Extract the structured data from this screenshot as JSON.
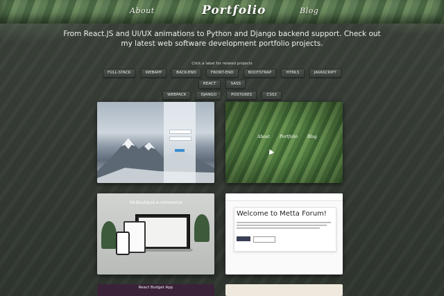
{
  "nav": {
    "about": "About",
    "brand": "Portfolio",
    "blog": "Blog"
  },
  "intro": "From React.JS and UI/UX animations to Python and Django backend support. Check out my latest web software development portfolio projects.",
  "filter_hint": "Click a label for related projects",
  "tags": [
    "FULL-STACK",
    "WEBAPP",
    "BACK-END",
    "FRONT-END",
    "BOOTSTRAP",
    "HTML5",
    "JAVASCRIPT",
    "REACT",
    "SASS",
    "WEBPACK",
    "DJANGO",
    "POSTGRES",
    "CSS3"
  ],
  "projects": {
    "leaves": {
      "about": "About",
      "brand": "Portfolio",
      "blog": "Blog"
    },
    "ecommerce": {
      "title": "VA-Boutique e-commerce"
    },
    "forum": {
      "title": "Welcome to Metta Forum!"
    },
    "budget": {
      "title": "React Budget App"
    }
  },
  "colors": {
    "background": "#343a34",
    "leaf_green": "#557350",
    "tag_bg": "#454a45",
    "forum_button": "#3b3f55"
  },
  "icons": [
    "cursor-icon"
  ]
}
